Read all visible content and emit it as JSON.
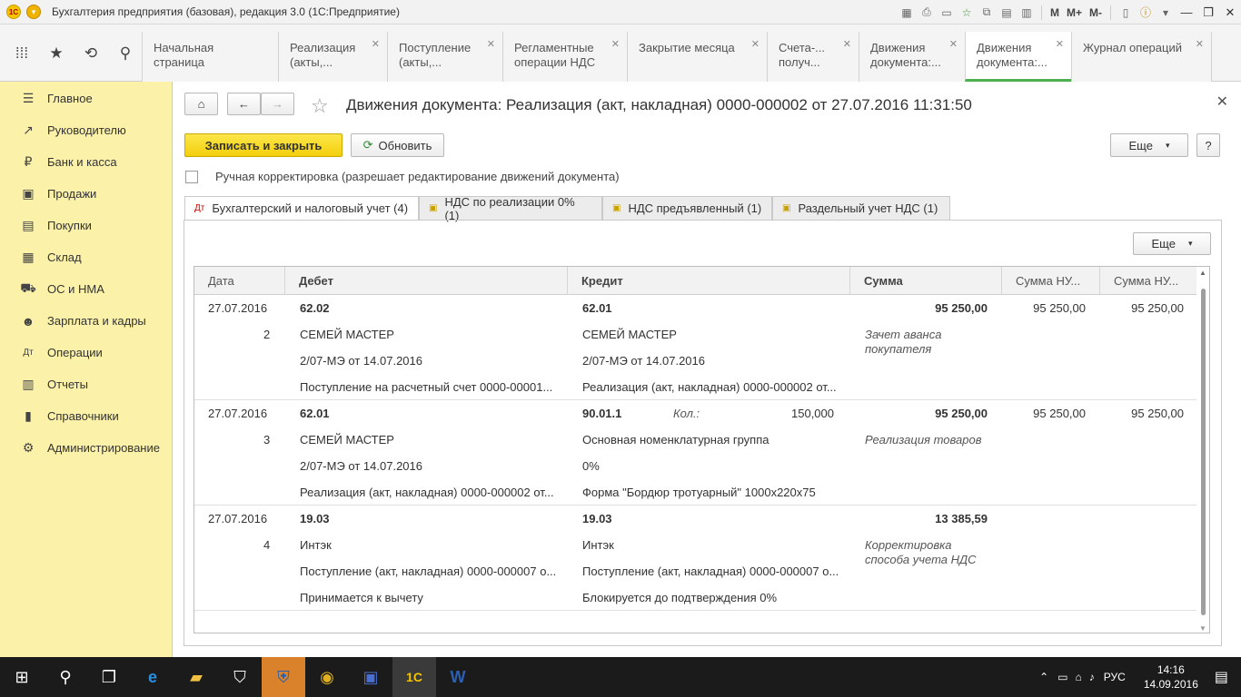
{
  "window": {
    "title": "Бухгалтерия предприятия (базовая), редакция 3.0  (1С:Предприятие)",
    "toolbar_text": [
      "M",
      "M+",
      "M-"
    ]
  },
  "top_tabs": [
    {
      "label": "Начальная страница"
    },
    {
      "label": "Реализация (акты,..."
    },
    {
      "label": "Поступление (акты,..."
    },
    {
      "label": "Регламентные операции НДС"
    },
    {
      "label": "Закрытие месяца"
    },
    {
      "label": "Счета-... получ..."
    },
    {
      "label": "Движения документа:..."
    },
    {
      "label": "Движения документа:..."
    },
    {
      "label": "Журнал операций"
    }
  ],
  "sidebar": {
    "items": [
      {
        "label": "Главное",
        "icon": "list-icon"
      },
      {
        "label": "Руководителю",
        "icon": "trend-icon"
      },
      {
        "label": "Банк и касса",
        "icon": "ruble-icon"
      },
      {
        "label": "Продажи",
        "icon": "cart-icon"
      },
      {
        "label": "Покупки",
        "icon": "bag-icon"
      },
      {
        "label": "Склад",
        "icon": "warehouse-icon"
      },
      {
        "label": "ОС и НМА",
        "icon": "truck-icon"
      },
      {
        "label": "Зарплата и кадры",
        "icon": "people-icon"
      },
      {
        "label": "Операции",
        "icon": "dt-kt-icon"
      },
      {
        "label": "Отчеты",
        "icon": "chart-icon"
      },
      {
        "label": "Справочники",
        "icon": "book-icon"
      },
      {
        "label": "Администрирование",
        "icon": "gear-icon"
      }
    ]
  },
  "form": {
    "title": "Движения документа: Реализация (акт, накладная) 0000-000002 от 27.07.2016 11:31:50",
    "save_close_label": "Записать и закрыть",
    "refresh_label": "Обновить",
    "more_label": "Еще",
    "help_label": "?",
    "manual_label": "Ручная корректировка (разрешает редактирование движений документа)",
    "tabs": [
      {
        "label": "Бухгалтерский и налоговый учет (4)"
      },
      {
        "label": "НДС по реализации 0% (1)"
      },
      {
        "label": "НДС предъявленный (1)"
      },
      {
        "label": "Раздельный учет НДС (1)"
      }
    ],
    "grid_more_label": "Еще"
  },
  "grid": {
    "headers": [
      "Дата",
      "Дебет",
      "Кредит",
      "Сумма",
      "Сумма НУ...",
      "Сумма НУ..."
    ],
    "rows": [
      {
        "date": "27.07.2016",
        "num": "2",
        "debit": [
          "62.02",
          "СЕМЕЙ МАСТЕР",
          "2/07-МЭ от 14.07.2016",
          "Поступление на расчетный счет 0000-00001..."
        ],
        "credit": [
          "62.01",
          "СЕМЕЙ МАСТЕР",
          "2/07-МЭ от 14.07.2016",
          "Реализация (акт, накладная) 0000-000002 от..."
        ],
        "qty_label": "",
        "qty": "",
        "sum": "95 250,00",
        "content": "Зачет аванса покупателя",
        "sum_nu1": "95 250,00",
        "sum_nu2": "95 250,00"
      },
      {
        "date": "27.07.2016",
        "num": "3",
        "debit": [
          "62.01",
          "СЕМЕЙ МАСТЕР",
          "2/07-МЭ от 14.07.2016",
          "Реализация (акт, накладная) 0000-000002 от..."
        ],
        "credit": [
          "90.01.1",
          "Основная номенклатурная группа",
          "0%",
          "Форма \"Бордюр тротуарный\" 1000х220х75"
        ],
        "qty_label": "Кол.:",
        "qty": "150,000",
        "sum": "95 250,00",
        "content": "Реализация товаров",
        "sum_nu1": "95 250,00",
        "sum_nu2": "95 250,00"
      },
      {
        "date": "27.07.2016",
        "num": "4",
        "debit": [
          "19.03",
          "Интэк",
          "Поступление (акт, накладная) 0000-000007 о...",
          "Принимается к вычету"
        ],
        "credit": [
          "19.03",
          "Интэк",
          "Поступление (акт, накладная) 0000-000007 о...",
          "Блокируется до подтверждения 0%"
        ],
        "qty_label": "",
        "qty": "",
        "sum": "13 385,59",
        "content": "Корректировка способа учета НДС",
        "sum_nu1": "",
        "sum_nu2": ""
      }
    ]
  },
  "taskbar": {
    "lang": "РУС",
    "time": "14:16",
    "date": "14.09.2016"
  }
}
